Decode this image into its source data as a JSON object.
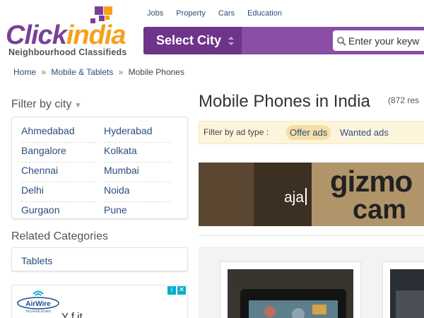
{
  "brand": {
    "name_part1": "Click",
    "name_part2": "india",
    "tagline": "Neighbourhood Classifieds",
    "colors": {
      "purple": "#7b3f98",
      "orange": "#f6a01a"
    }
  },
  "topnav": {
    "items": [
      "Jobs",
      "Property",
      "Cars",
      "Education"
    ]
  },
  "header": {
    "city_select_label": "Select City",
    "search_placeholder": "Enter your keyw",
    "search_icon": "search-icon"
  },
  "breadcrumb": {
    "items": [
      "Home",
      "Mobile & Tablets",
      "Mobile Phones"
    ],
    "separator": "»"
  },
  "filter_city": {
    "title": "Filter by city",
    "caret": "▼",
    "cities_left": [
      "Ahmedabad",
      "Bangalore",
      "Chennai",
      "Delhi",
      "Gurgaon"
    ],
    "cities_right": [
      "Hyderabad",
      "Kolkata",
      "Mumbai",
      "Noida",
      "Pune"
    ]
  },
  "related": {
    "title": "Related Categories",
    "items": [
      "Tablets"
    ]
  },
  "ad": {
    "brand": "AirWire",
    "brand_sub": "TECHNOLOGIES",
    "text_partial": "Y     f      it",
    "icons": [
      "info-icon",
      "close-icon"
    ]
  },
  "main": {
    "title": "Mobile Phones in India",
    "count": "(872 res",
    "adtype": {
      "label": "Filter by ad type :",
      "offer": "Offer ads",
      "wanted": "Wanted ads"
    },
    "banner": {
      "caption": "aja",
      "brand_line1": "gizmo",
      "brand_line2": "cam"
    }
  }
}
